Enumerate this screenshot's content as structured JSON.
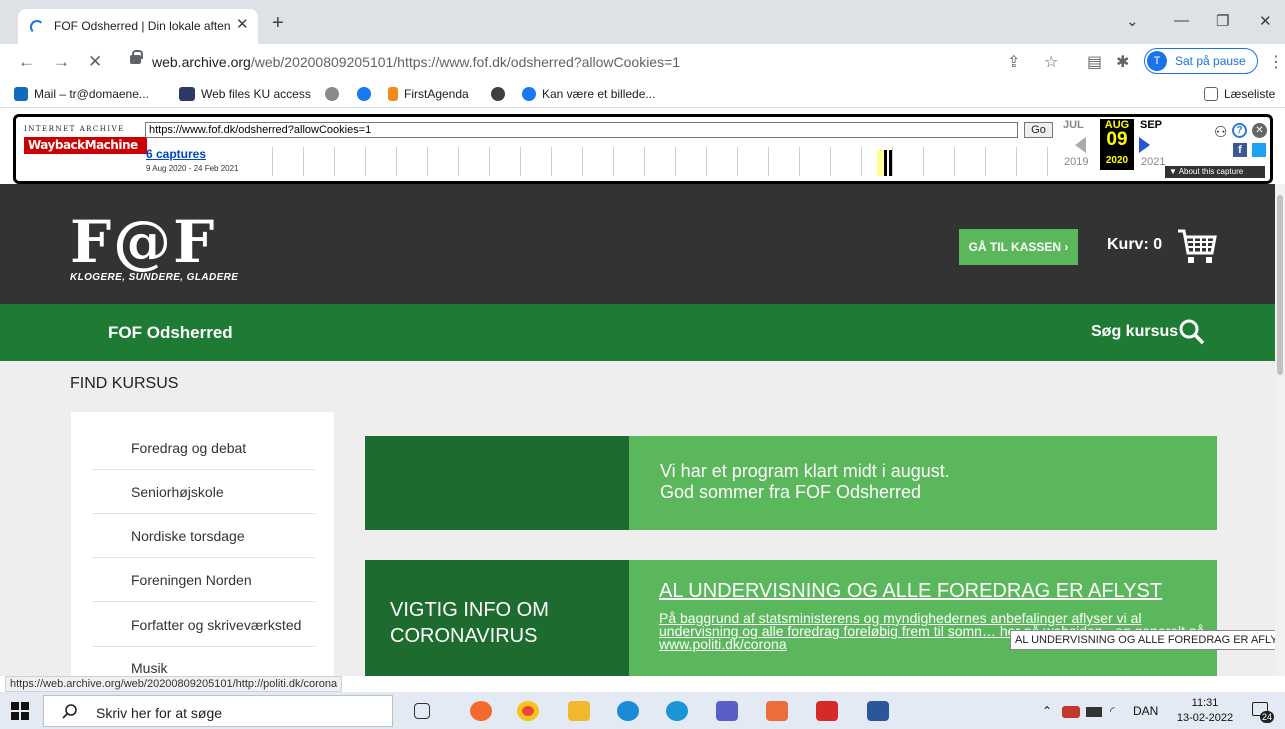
{
  "browser": {
    "tab_title": "FOF Odsherred | Din lokale aften",
    "url_host": "web.archive.org",
    "url_path": "/web/20200809205101/https://www.fof.dk/odsherred?allowCookies=1",
    "profile_initial": "T",
    "profile_status": "Sat på pause",
    "reading_list": "Læseliste",
    "bookmarks": [
      "Mail – tr@domaene...",
      "Web files KU access",
      "FirstAgenda",
      "Kan være et billede..."
    ]
  },
  "wayback": {
    "ia_label": "INTERNET ARCHIVE",
    "logo": "WaybackMachine",
    "url_value": "https://www.fof.dk/odsherred?allowCookies=1",
    "go": "Go",
    "captures": "6 captures",
    "range": "9 Aug 2020 - 24 Feb 2021",
    "months": [
      "JUL",
      "AUG",
      "SEP"
    ],
    "day": "09",
    "years": [
      "2019",
      "2020",
      "2021"
    ],
    "about": "▼ About this capture"
  },
  "site": {
    "logo": "F@F",
    "tagline": "KLOGERE, SUNDERE, GLADERE",
    "checkout": "GÅ TIL KASSEN ›",
    "basket": "Kurv: 0",
    "nav_title": "FOF Odsherred",
    "search": "Søg kursus",
    "find_heading": "FIND KURSUS",
    "sidebar": [
      "Foredrag og debat",
      "Seniorhøjskole",
      "Nordiske torsdage",
      "Foreningen Norden",
      "Forfatter og skriveværksted",
      "Musik"
    ],
    "banner1_line1": "Vi har et program klart midt i august.",
    "banner1_line2": "God sommer fra FOF Odsherred",
    "banner2_left_1": "VIGTIG INFO OM",
    "banner2_left_2": "CORONAVIRUS",
    "banner2_title": "AL UNDERVISNING OG ALLE FOREDRAG ER AFLYST",
    "banner2_body": "På baggrund af statsministerens og myndighedernes anbefalinger aflyser vi al undervisning og alle foredrag foreløbig frem til somn… her på websiden - og generelt på www.politi.dk/corona",
    "tooltip": "AL UNDERVISNING OG ALLE FOREDRAG ER AFLYST"
  },
  "status_url": "https://web.archive.org/web/20200809205101/http://politi.dk/corona",
  "taskbar": {
    "search": "Skriv her for at søge",
    "lang": "DAN",
    "time": "11:31",
    "date": "13-02-2022",
    "notifications": "24"
  },
  "colors": {
    "header_bg": "#333333",
    "nav_green": "#1e7b34",
    "banner_dark": "#1e6b30",
    "banner_light": "#5bb75b",
    "wayback_red": "#cc0000"
  }
}
